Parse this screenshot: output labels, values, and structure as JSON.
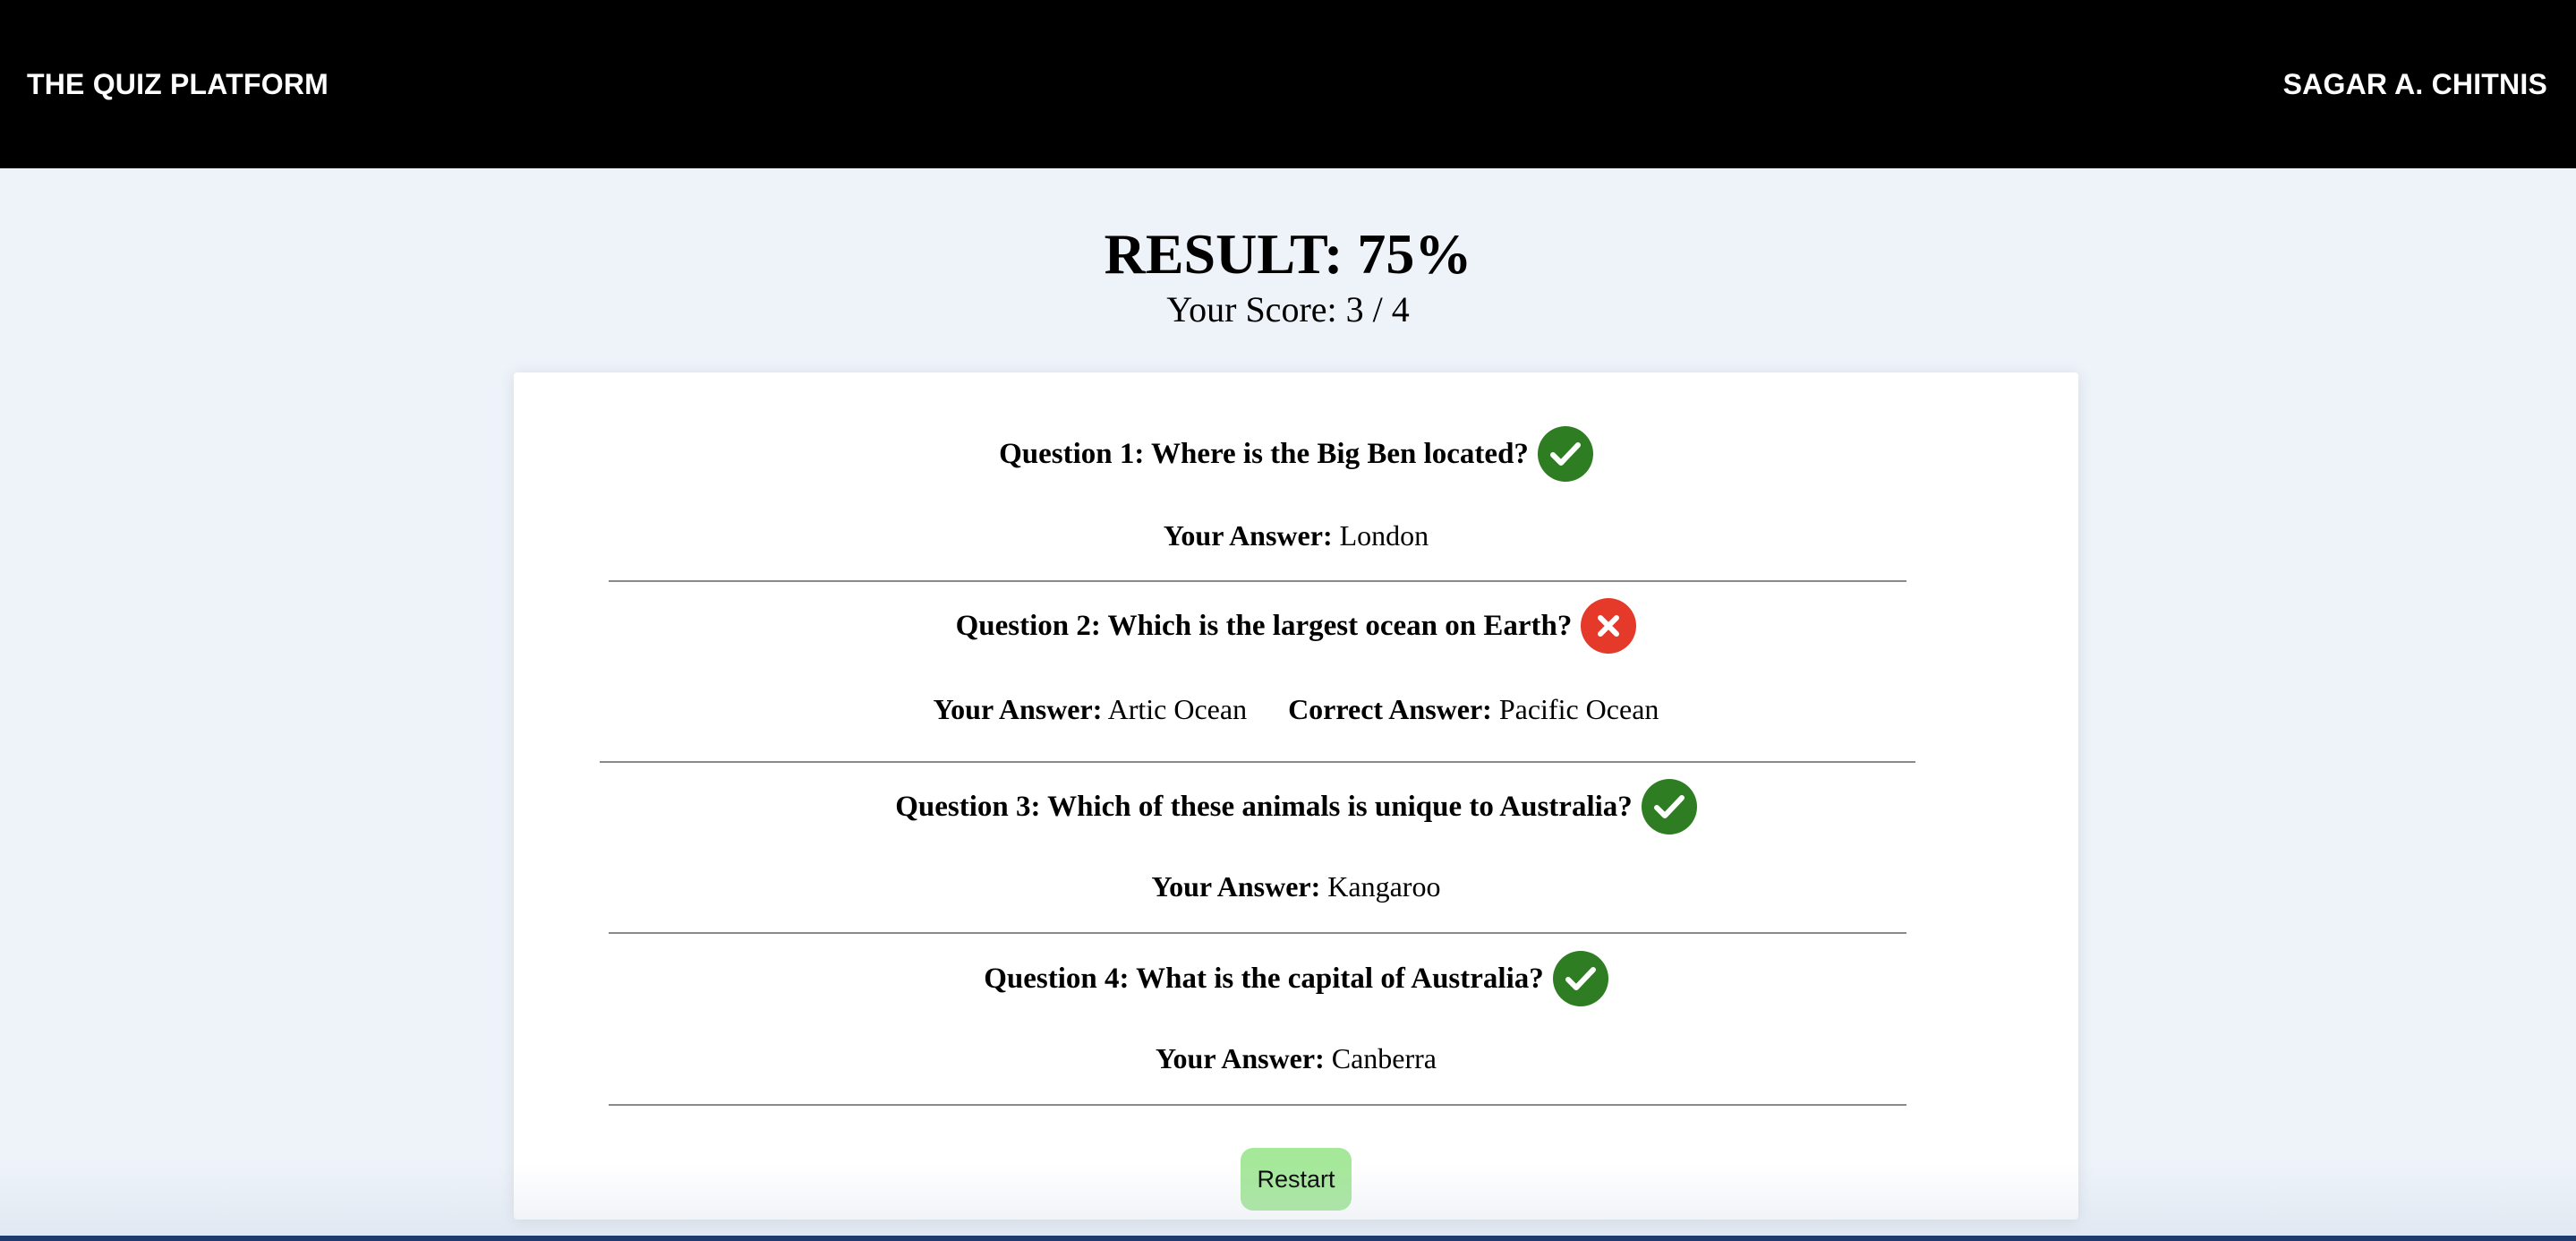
{
  "header": {
    "brand": "THE QUIZ PLATFORM",
    "user": "SAGAR A. CHITNIS"
  },
  "result": {
    "title": "RESULT: 75%",
    "score_line": "Your Score: 3 / 4"
  },
  "labels": {
    "your_answer": "Your Answer:",
    "correct_answer": "Correct Answer:"
  },
  "questions": [
    {
      "title": "Question 1: Where is the Big Ben located?",
      "status": "correct",
      "status_icon": "check-circle-icon",
      "your_answer": "London"
    },
    {
      "title": "Question 2: Which is the largest ocean on Earth?",
      "status": "wrong",
      "status_icon": "x-circle-icon",
      "your_answer": "Artic Ocean",
      "correct_answer": "Pacific Ocean"
    },
    {
      "title": "Question 3: Which of these animals is unique to Australia?",
      "status": "correct",
      "status_icon": "check-circle-icon",
      "your_answer": "Kangaroo"
    },
    {
      "title": "Question 4: What is the capital of Australia?",
      "status": "correct",
      "status_icon": "check-circle-icon",
      "your_answer": "Canberra"
    }
  ],
  "restart_label": "Restart",
  "colors": {
    "header_bg": "#000000",
    "page_bg": "#eef3fa",
    "correct": "#2e7d22",
    "wrong": "#e53a2a",
    "restart_bg": "#a5e89a"
  }
}
